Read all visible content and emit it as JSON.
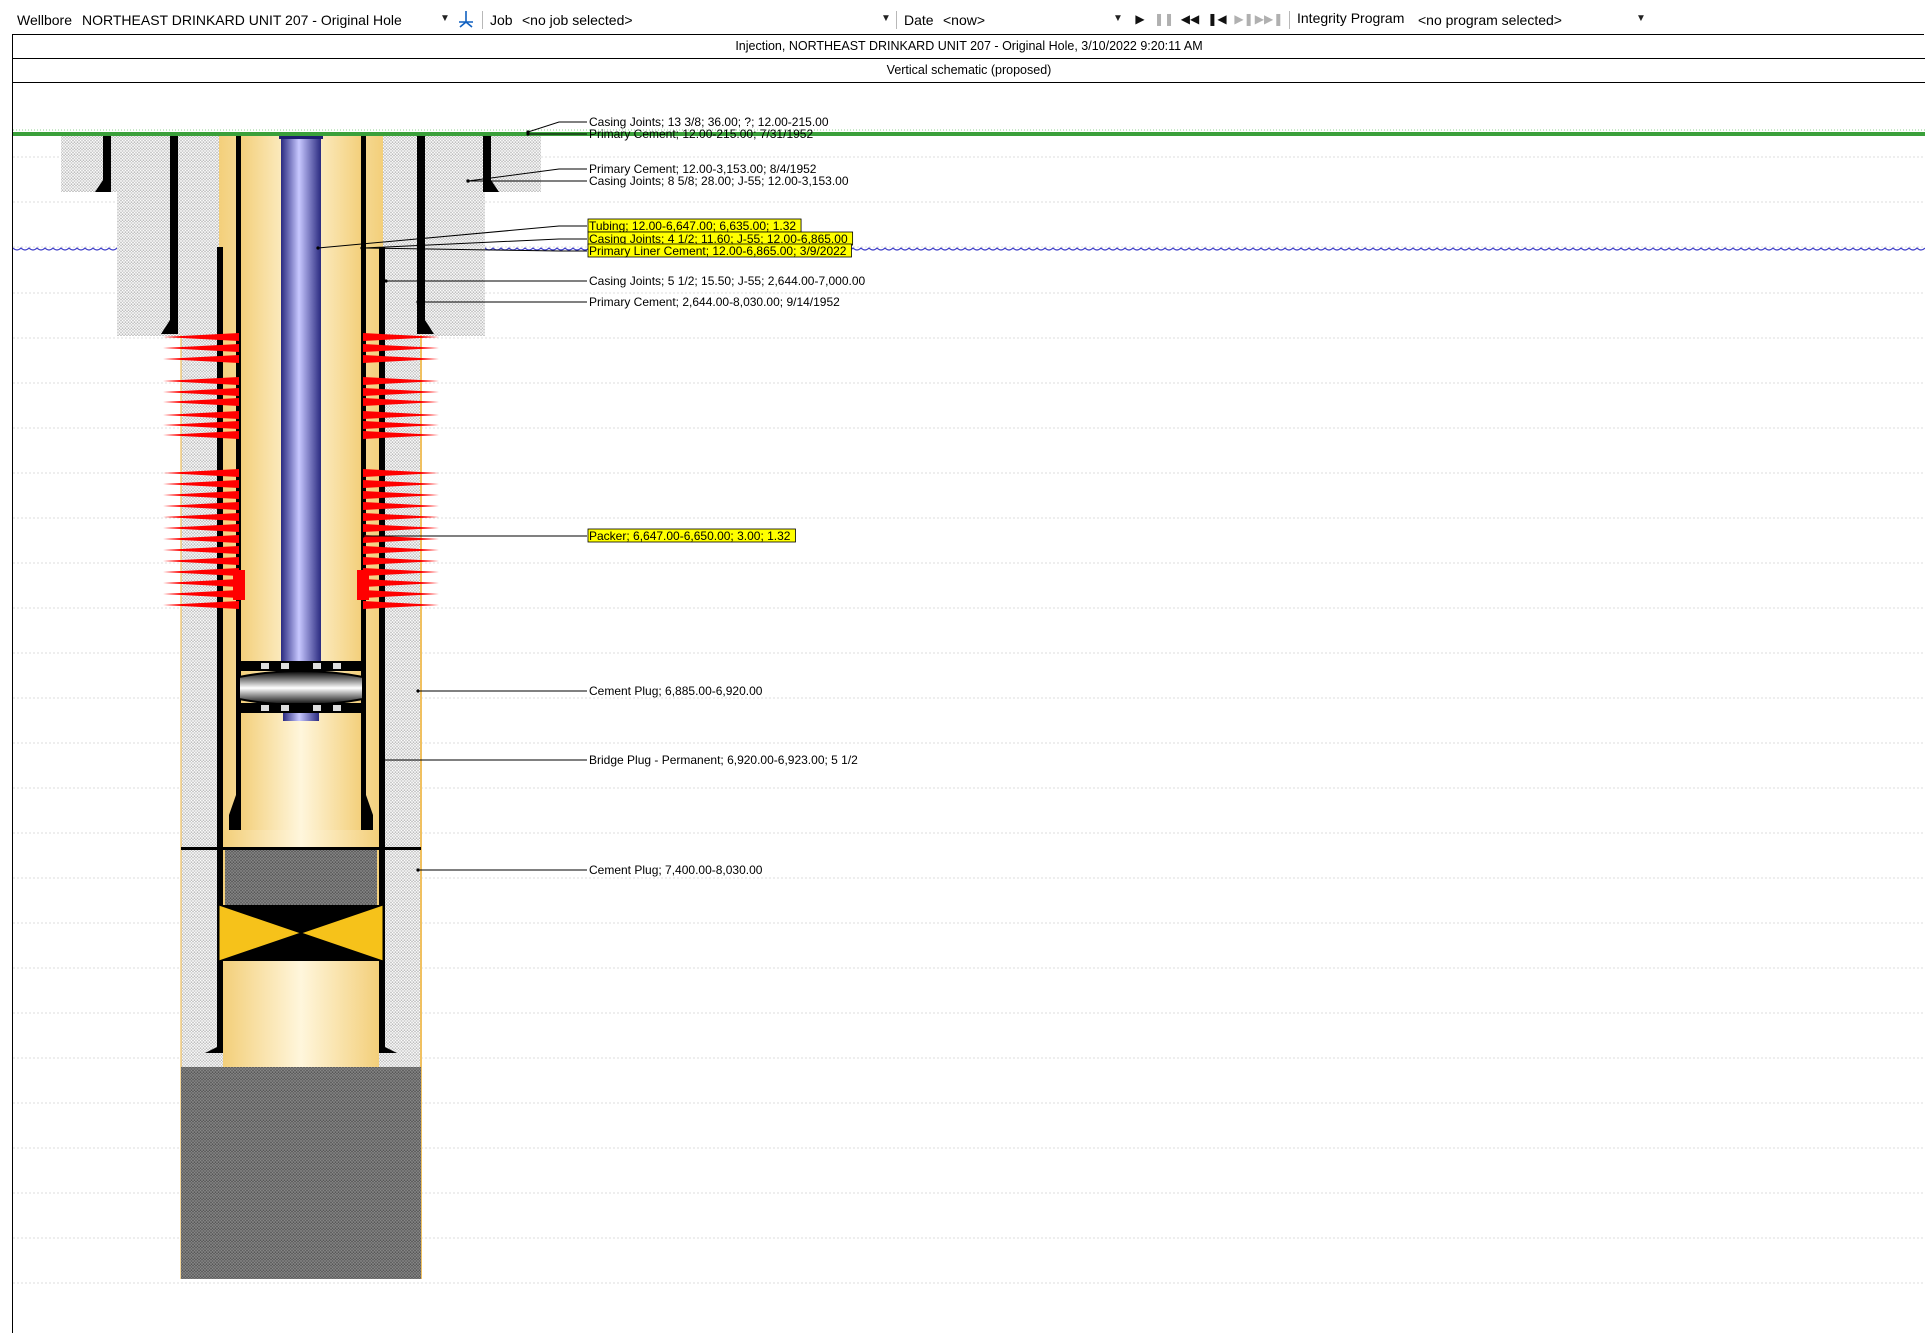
{
  "toolbar": {
    "wellbore_label": "Wellbore",
    "wellbore_value": "NORTHEAST DRINKARD UNIT 207 - Original Hole",
    "job_label": "Job",
    "job_value": "<no job selected>",
    "date_label": "Date",
    "date_value": "<now>",
    "integrity_label": "Integrity Program",
    "integrity_value": "<no program selected>",
    "icons": [
      "wellbore-picker-icon",
      "play-icon",
      "pause-icon",
      "first-frame-icon",
      "previous-frame-icon",
      "next-frame-icon",
      "last-frame-icon"
    ]
  },
  "schematic": {
    "title": "Injection, NORTHEAST DRINKARD UNIT 207 - Original Hole, 3/10/2022 9:20:11 AM",
    "subtitle": "Vertical schematic (proposed)",
    "annotations": [
      {
        "text": "Casing Joints; 13 3/8; 36.00; ?; 12.00-215.00",
        "highlight": false
      },
      {
        "text": "Primary Cement; 12.00-215.00; 7/31/1952",
        "highlight": false
      },
      {
        "text": "Primary Cement; 12.00-3,153.00; 8/4/1952",
        "highlight": false
      },
      {
        "text": "Casing Joints; 8 5/8; 28.00; J-55; 12.00-3,153.00",
        "highlight": false
      },
      {
        "text": "Tubing; 12.00-6,647.00; 6,635.00; 1.32",
        "highlight": true
      },
      {
        "text": "Casing Joints; 4 1/2; 11.60; J-55; 12.00-6,865.00",
        "highlight": true
      },
      {
        "text": "Primary Liner Cement; 12.00-6,865.00; 3/9/2022",
        "highlight": true
      },
      {
        "text": "Casing Joints; 5 1/2; 15.50; J-55; 2,644.00-7,000.00",
        "highlight": false
      },
      {
        "text": "Primary Cement; 2,644.00-8,030.00; 9/14/1952",
        "highlight": false
      },
      {
        "text": "Packer; 6,647.00-6,650.00; 3.00; 1.32",
        "highlight": true
      },
      {
        "text": "Cement Plug; 6,885.00-6,920.00",
        "highlight": false
      },
      {
        "text": "Bridge Plug - Permanent; 6,920.00-6,923.00; 5 1/2",
        "highlight": false
      },
      {
        "text": "Cement Plug; 7,400.00-8,030.00",
        "highlight": false
      }
    ]
  },
  "colors": {
    "highlight": "#ffff00",
    "perforation": "#ff0000",
    "tubing": "#4a4aa8",
    "fluid": "#fde7b0",
    "ground_line": "#3aa03a",
    "water_line": "#4040c8",
    "bridge_plug": "#f6c21a"
  }
}
